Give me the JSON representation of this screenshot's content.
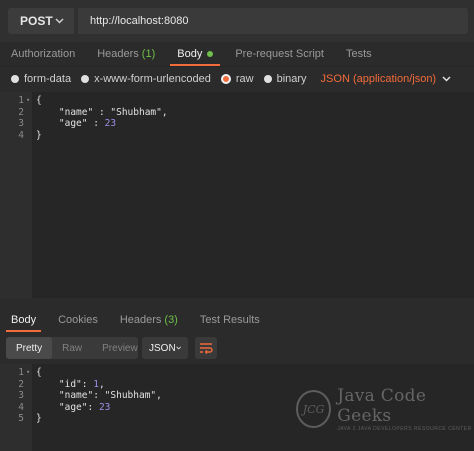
{
  "request": {
    "method": "POST",
    "url": "http://localhost:8080"
  },
  "request_tabs": [
    {
      "label": "Authorization"
    },
    {
      "label": "Headers",
      "count": "(1)"
    },
    {
      "label": "Body"
    },
    {
      "label": "Pre-request Script"
    },
    {
      "label": "Tests"
    }
  ],
  "body_types": {
    "form_data": "form-data",
    "urlencoded": "x-www-form-urlencoded",
    "raw": "raw",
    "binary": "binary",
    "content_type": "JSON (application/json)"
  },
  "request_body": {
    "line_numbers": [
      "1",
      "2",
      "3",
      "4"
    ],
    "line1": "{",
    "name_key": "\"name\"",
    "name_sep": " : ",
    "name_val": "\"Shubham\"",
    "name_comma": ",",
    "age_key": "\"age\"",
    "age_sep": " : ",
    "age_val": "23",
    "line4": "}"
  },
  "response_tabs": [
    {
      "label": "Body"
    },
    {
      "label": "Cookies"
    },
    {
      "label": "Headers",
      "count": "(3)"
    },
    {
      "label": "Test Results"
    }
  ],
  "response_toolbar": {
    "pretty": "Pretty",
    "raw": "Raw",
    "preview": "Preview",
    "format": "JSON"
  },
  "response_body": {
    "line_numbers": [
      "1",
      "2",
      "3",
      "4",
      "5"
    ],
    "line1": "{",
    "id_key": "\"id\"",
    "id_sep": ": ",
    "id_val": "1",
    "id_comma": ",",
    "name_key": "\"name\"",
    "name_sep": ": ",
    "name_val": "\"Shubham\"",
    "name_comma": ",",
    "age_key": "\"age\"",
    "age_sep": ": ",
    "age_val": "23",
    "line5": "}"
  },
  "watermark": {
    "logo_text": "JCG",
    "title": "Java Code Geeks",
    "subtitle": "JAVA 2 JAVA DEVELOPERS RESOURCE CENTER"
  },
  "colors": {
    "accent": "#f26b3a",
    "count_green": "#6fbf4a",
    "number_purple": "#9d8ee6"
  }
}
